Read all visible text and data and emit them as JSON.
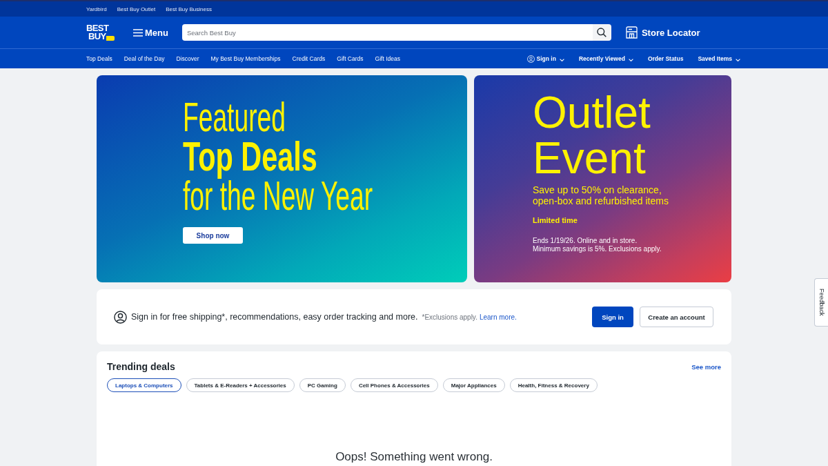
{
  "utility_bar": {
    "links": [
      "Yardbird",
      "Best Buy Outlet",
      "Best Buy Business"
    ]
  },
  "header": {
    "logo": {
      "lines": [
        "BEST",
        "BUY"
      ]
    },
    "menu_button": {
      "label": "Menu"
    },
    "search": {
      "placeholder": "Search Best Buy"
    },
    "store_locator": {
      "label": "Store Locator"
    }
  },
  "nav": {
    "links": [
      "Top Deals",
      "Deal of the Day",
      "Discover",
      "My Best Buy Memberships",
      "Credit Cards",
      "Gift Cards",
      "Gift Ideas"
    ],
    "account_links": [
      {
        "label": "Sign in",
        "kind": "account"
      },
      {
        "label": "Recently Viewed",
        "kind": "dropdown"
      },
      {
        "label": "Order Status",
        "kind": "link"
      },
      {
        "label": "Saved Items",
        "kind": "dropdown"
      }
    ]
  },
  "banners": [
    {
      "kind": "featured",
      "headline": [
        {
          "text": "Featured",
          "kind": "light"
        },
        {
          "text": "Top Deals",
          "kind": "bold"
        },
        {
          "text": "for the New Year",
          "kind": "light"
        }
      ],
      "button": "Shop now"
    },
    {
      "kind": "outlet",
      "title": "Outlet Event",
      "subtitle": "Save up to 50% on clearance, open-box and refurbished items",
      "tag": "Limited time",
      "fine_print": [
        "Ends 1/19/26. Online and in store.",
        "Minimum savings is 5%. Exclusions apply."
      ]
    }
  ],
  "signin_prompt": {
    "message": "Sign in for free shipping*, recommendations, easy order tracking and more.",
    "note": "*Exclusions apply.",
    "link": "Learn more.",
    "buttons": [
      {
        "label": "Sign in",
        "kind": "primary"
      },
      {
        "label": "Create an account",
        "kind": "secondary"
      }
    ]
  },
  "trending": {
    "title": "Trending deals",
    "see_more": "See more",
    "chips": [
      {
        "label": "Laptops & Computers",
        "selected": true
      },
      {
        "label": "Tablets & E-Readers + Accessories",
        "selected": false
      },
      {
        "label": "PC Gaming",
        "selected": false
      },
      {
        "label": "Cell Phones & Accessories",
        "selected": false
      },
      {
        "label": "Major Appliances",
        "selected": false
      },
      {
        "label": "Health, Fitness & Recovery",
        "selected": false
      }
    ],
    "error": "Oops! Something went wrong."
  },
  "feedback_tab": {
    "label": "Feedback"
  }
}
